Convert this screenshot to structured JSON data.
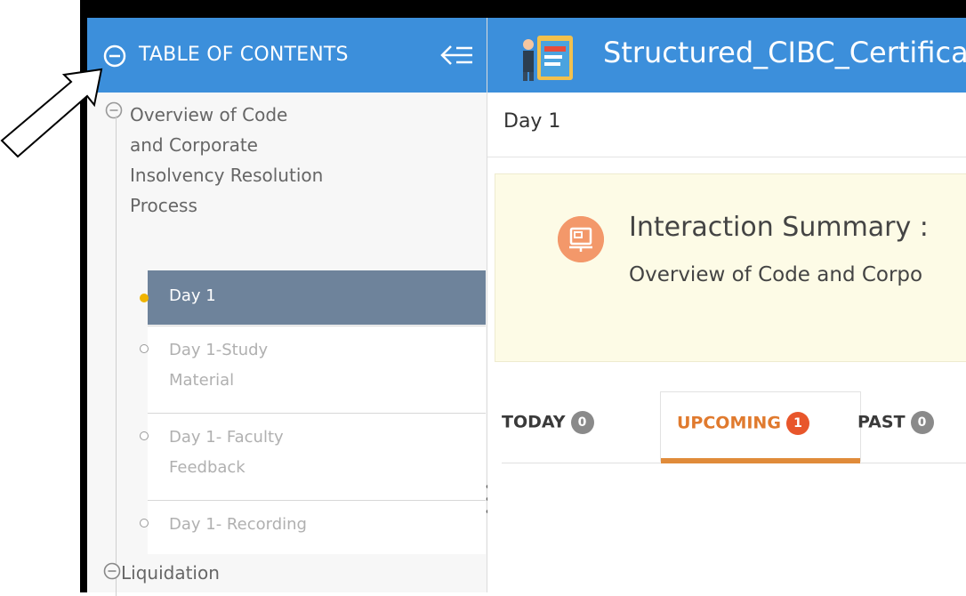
{
  "sidebar": {
    "toc_title": "TABLE OF CONTENTS",
    "course_title": "Overview of Code and Corporate Insolvency Resolution Process",
    "items": [
      {
        "label": "Day 1",
        "active": true
      },
      {
        "label": "Day 1-Study Material",
        "active": false
      },
      {
        "label": "Day 1- Faculty Feedback",
        "active": false
      },
      {
        "label": "Day 1- Recording",
        "active": false
      }
    ],
    "next_section": "Liquidation"
  },
  "header": {
    "course_name": "Structured_CIBC_Certificat"
  },
  "breadcrumb": "Day 1",
  "summary": {
    "title": "Interaction Summary :",
    "subtitle": "Overview of Code and Corpo"
  },
  "tabs": [
    {
      "label": "TODAY",
      "count": "0"
    },
    {
      "label": "UPCOMING",
      "count": "1"
    },
    {
      "label": "PAST",
      "count": "0"
    }
  ],
  "colors": {
    "header_blue": "#3c8fdb",
    "active_item": "#6e839b",
    "accent_orange": "#e07a2e",
    "summary_bg": "#fdfbe6"
  }
}
